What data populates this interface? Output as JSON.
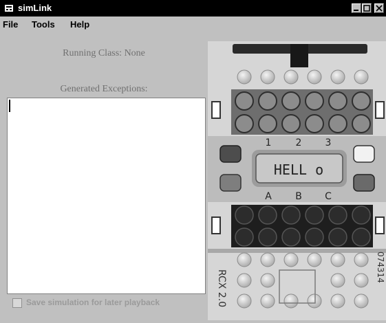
{
  "window": {
    "title": "simLink"
  },
  "menu": [
    {
      "label": "File"
    },
    {
      "label": "Tools"
    },
    {
      "label": "Help"
    }
  ],
  "status": {
    "running_class": "Running Class: None",
    "exceptions_label": "Generated Exceptions:"
  },
  "save_option": {
    "label": "Save simulation for later playback",
    "checked": false
  },
  "rcx": {
    "program_numbers": [
      "1",
      "2",
      "3"
    ],
    "display": "HELL o",
    "port_letters": [
      "A",
      "B",
      "C"
    ],
    "model_left": "RCX 2.0",
    "model_right": "074314"
  }
}
